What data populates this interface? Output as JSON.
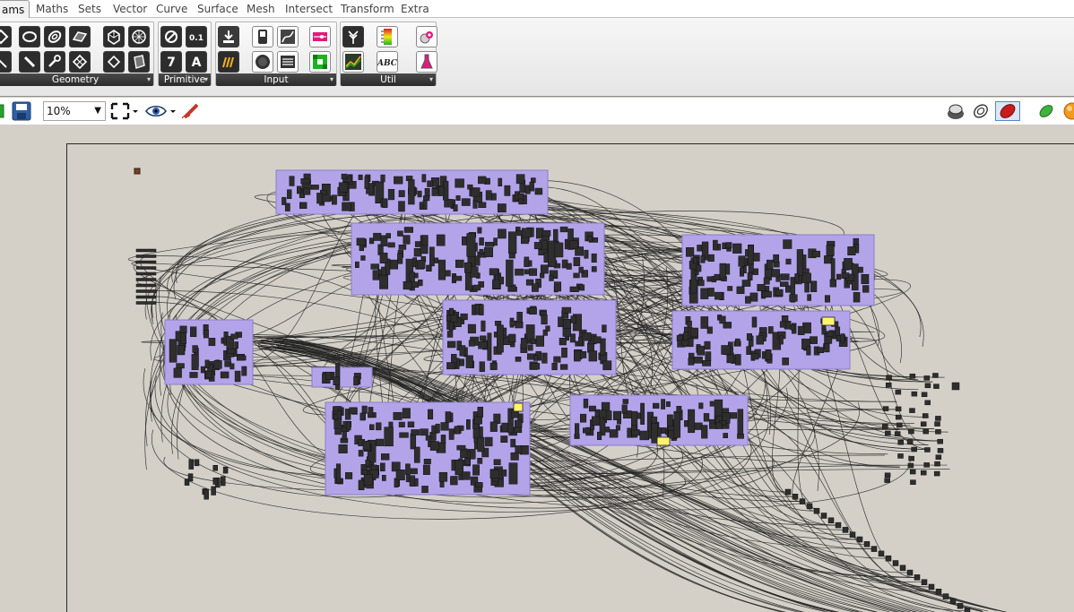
{
  "tabs": [
    {
      "label": "ams",
      "active": true
    },
    {
      "label": "Maths"
    },
    {
      "label": "Sets"
    },
    {
      "label": "Vector"
    },
    {
      "label": "Curve"
    },
    {
      "label": "Surface"
    },
    {
      "label": "Mesh"
    },
    {
      "label": "Intersect"
    },
    {
      "label": "Transform"
    },
    {
      "label": "Extra"
    }
  ],
  "ribbon": {
    "panels": [
      {
        "label": "Geometry"
      },
      {
        "label": "Primitive"
      },
      {
        "label": "Input"
      },
      {
        "label": "Util"
      }
    ],
    "primitive_glyphs": [
      "0.1",
      "7",
      "A"
    ],
    "util_glyph": "ABC"
  },
  "toolbar": {
    "zoom_value": "10%"
  },
  "colors": {
    "canvas": "#d4d0c8",
    "group_fill": "#b3a4ea",
    "group_border": "#8c7cc7",
    "panel_label": "#2b2b2b",
    "yellow_panel": "#fff46a"
  }
}
